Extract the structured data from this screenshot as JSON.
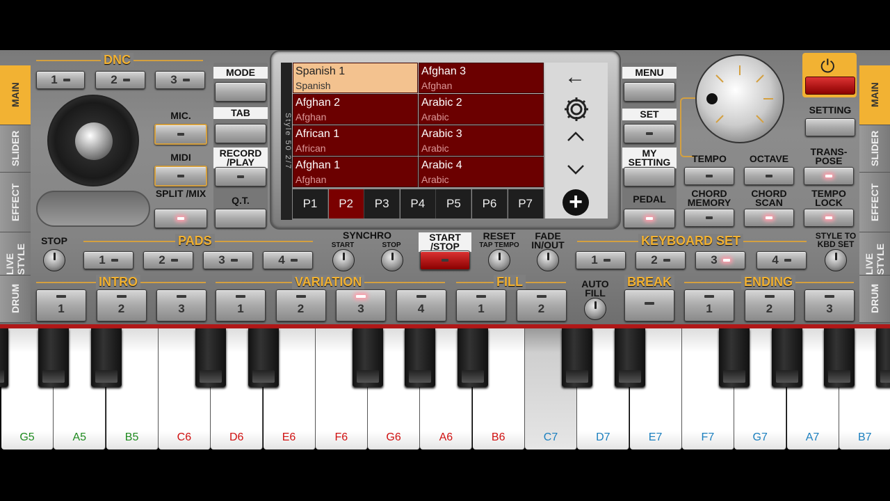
{
  "left_tabs": [
    "MAIN",
    "SLIDER",
    "EFFECT",
    "LIVE STYLE",
    "DRUM"
  ],
  "right_tabs": [
    "MAIN",
    "SLIDER",
    "EFFECT",
    "LIVE STYLE",
    "DRUM"
  ],
  "dnc": {
    "title": "DNC",
    "buttons": [
      "1",
      "2",
      "3"
    ]
  },
  "left_col": {
    "mic": "MIC.",
    "midi": "MIDI",
    "split": "SPLIT /MIX"
  },
  "mid_col": {
    "mode": "MODE",
    "tab": "TAB",
    "record": "RECORD /PLAY",
    "qt": "Q.T."
  },
  "screen": {
    "vertical_label": "Style 50 2/7",
    "styles": [
      {
        "name": "Spanish 1",
        "sub": "Spanish",
        "selected": true
      },
      {
        "name": "Afghan 3",
        "sub": "Afghan"
      },
      {
        "name": "Afghan 2",
        "sub": "Afghan"
      },
      {
        "name": "Arabic 2",
        "sub": "Arabic"
      },
      {
        "name": "African 1",
        "sub": "African"
      },
      {
        "name": "Arabic 3",
        "sub": "Arabic"
      },
      {
        "name": "Afghan 1",
        "sub": "Afghan"
      },
      {
        "name": "Arabic 4",
        "sub": "Arabic"
      }
    ],
    "pages": [
      "P1",
      "P2",
      "P3",
      "P4",
      "P5",
      "P6",
      "P7"
    ],
    "active_page": "P2"
  },
  "right_col": {
    "menu": "MENU",
    "set": "SET",
    "my_setting": "MY SETTING",
    "pedal": "PEDAL"
  },
  "far_right": {
    "setting": "SETTING",
    "tempo": "TEMPO",
    "octave": "OCTAVE",
    "transpose": "TRANS- POSE",
    "chord_memory": "CHORD MEMORY",
    "chord_scan": "CHORD SCAN",
    "tempo_lock": "TEMPO LOCK"
  },
  "row_pads": {
    "stop": "STOP",
    "pads": "PADS",
    "pad_buttons": [
      "1",
      "2",
      "3",
      "4"
    ],
    "synchro": "SYNCHRO",
    "synchro_start": "START",
    "synchro_stop": "STOP",
    "start_stop": "START /STOP",
    "reset": "RESET",
    "tap_tempo": "TAP TEMPO",
    "fade": "FADE IN/OUT",
    "keyboard_set": "KEYBOARD SET",
    "kbd_buttons": [
      "1",
      "2",
      "3",
      "4"
    ],
    "style_to_kbd": "STYLE TO KBD SET"
  },
  "row_bottom": {
    "intro": "INTRO",
    "intro_buttons": [
      "1",
      "2",
      "3"
    ],
    "variation": "VARIATION",
    "variation_buttons": [
      "1",
      "2",
      "3",
      "4"
    ],
    "fill": "FILL",
    "fill_buttons": [
      "1",
      "2"
    ],
    "auto_fill": "AUTO FILL",
    "break": "BREAK",
    "ending": "ENDING",
    "ending_buttons": [
      "1",
      "2",
      "3"
    ]
  },
  "keys": [
    {
      "note": "G5",
      "color": "#1e8a1e"
    },
    {
      "note": "A5",
      "color": "#1e8a1e"
    },
    {
      "note": "B5",
      "color": "#1e8a1e"
    },
    {
      "note": "C6",
      "color": "#d01010"
    },
    {
      "note": "D6",
      "color": "#d01010"
    },
    {
      "note": "E6",
      "color": "#d01010"
    },
    {
      "note": "F6",
      "color": "#d01010"
    },
    {
      "note": "G6",
      "color": "#d01010"
    },
    {
      "note": "A6",
      "color": "#d01010"
    },
    {
      "note": "B6",
      "color": "#d01010"
    },
    {
      "note": "C7",
      "color": "#1a7fbf"
    },
    {
      "note": "D7",
      "color": "#1a7fbf"
    },
    {
      "note": "E7",
      "color": "#1a7fbf"
    },
    {
      "note": "F7",
      "color": "#1a7fbf"
    },
    {
      "note": "G7",
      "color": "#1a7fbf"
    },
    {
      "note": "A7",
      "color": "#1a7fbf"
    },
    {
      "note": "B7",
      "color": "#1a7fbf"
    }
  ],
  "pressed_key": "C7"
}
